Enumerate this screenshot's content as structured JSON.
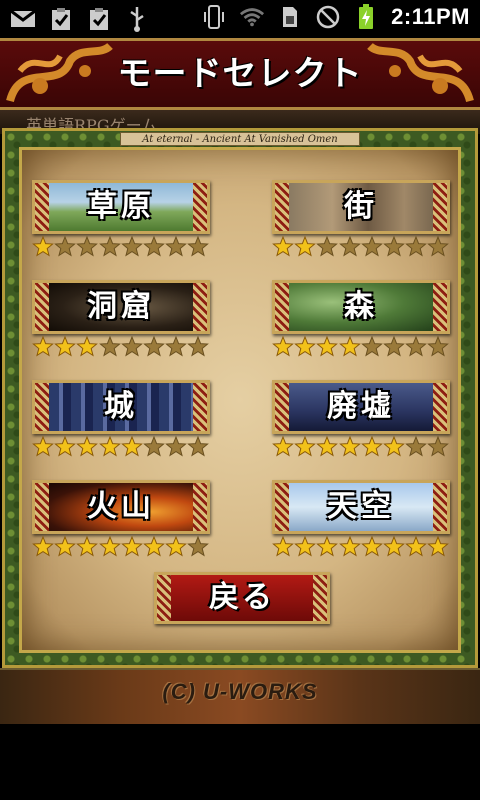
{
  "status_bar": {
    "time": "2:11PM",
    "icons_left": [
      "gmail-icon",
      "clipboard-check-icon",
      "clipboard-check-icon",
      "usb-icon"
    ],
    "icons_right": [
      "vibrate-icon",
      "wifi-icon",
      "sim-icon",
      "no-signal-icon",
      "battery-charging-icon"
    ]
  },
  "header": {
    "title": "モードセレクト",
    "subtitle": "英単語RPGゲーム",
    "tagline": "At eternal - Ancient At Vanished Omen"
  },
  "modes": [
    {
      "label": "草原",
      "stars_filled": 1,
      "stars_total": 8,
      "theme": "grassland"
    },
    {
      "label": "街",
      "stars_filled": 2,
      "stars_total": 8,
      "theme": "town"
    },
    {
      "label": "洞窟",
      "stars_filled": 3,
      "stars_total": 8,
      "theme": "cave"
    },
    {
      "label": "森",
      "stars_filled": 4,
      "stars_total": 8,
      "theme": "forest"
    },
    {
      "label": "城",
      "stars_filled": 5,
      "stars_total": 8,
      "theme": "castle"
    },
    {
      "label": "廃墟",
      "stars_filled": 6,
      "stars_total": 8,
      "theme": "ruins"
    },
    {
      "label": "火山",
      "stars_filled": 7,
      "stars_total": 8,
      "theme": "volcano"
    },
    {
      "label": "天空",
      "stars_filled": 8,
      "stars_total": 8,
      "theme": "sky"
    }
  ],
  "back_button": {
    "label": "戻る"
  },
  "footer": {
    "text": "(C) U-WORKS"
  },
  "colors": {
    "star_filled": "#f2c21a",
    "star_empty": "#9a7a3a",
    "banner_red": "#5a0b0b",
    "gold_border": "#c8a55a"
  }
}
